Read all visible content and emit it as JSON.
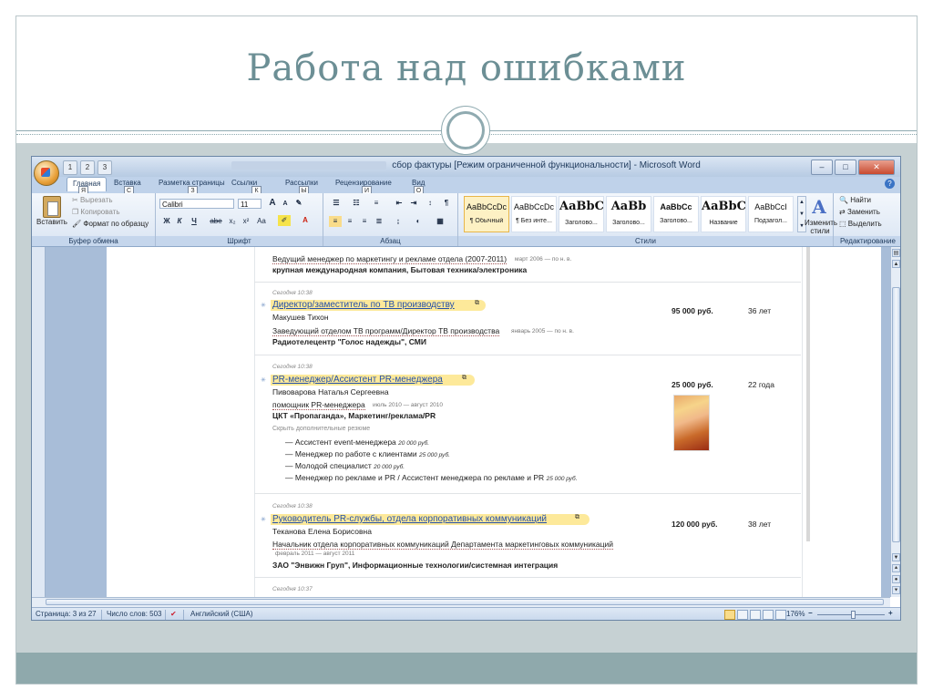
{
  "slide": {
    "title": "Работа над ошибками"
  },
  "window": {
    "title": "сбор фактуры [Режим ограниченной функциональности] - Microsoft Word",
    "controls": {
      "minimize": "–",
      "maximize": "□",
      "close": "✕"
    }
  },
  "qat": {
    "keys": [
      "1",
      "2",
      "3"
    ]
  },
  "ribbon": {
    "tabs": [
      {
        "label": "Главная",
        "key": "Я"
      },
      {
        "label": "Вставка",
        "key": "С"
      },
      {
        "label": "Разметка страницы",
        "key": "З"
      },
      {
        "label": "Ссылки",
        "key": "К"
      },
      {
        "label": "Рассылки",
        "key": "Ы"
      },
      {
        "label": "Рецензирование",
        "key": "И"
      },
      {
        "label": "Вид",
        "key": "О"
      }
    ],
    "help": "?",
    "clipboard": {
      "label": "Буфер обмена",
      "paste": "Вставить",
      "cut": "Вырезать",
      "copy": "Копировать",
      "format_painter": "Формат по образцу"
    },
    "font": {
      "label": "Шрифт",
      "family": "Calibri",
      "size": "11",
      "grow": "A",
      "shrink": "A",
      "bold": "Ж",
      "italic": "К",
      "underline": "Ч",
      "strike": "abe",
      "subscript": "x₂",
      "superscript": "x²",
      "case": "Aa"
    },
    "paragraph": {
      "label": "Абзац"
    },
    "styles": {
      "label": "Стили",
      "items": [
        {
          "sample": "AaBbCcDc",
          "name": "¶ Обычный"
        },
        {
          "sample": "AaBbCcDc",
          "name": "¶ Без инте..."
        },
        {
          "sample": "AaBbC",
          "name": "Заголово..."
        },
        {
          "sample": "AaBb",
          "name": "Заголово..."
        },
        {
          "sample": "AaBbCc",
          "name": "Заголово..."
        },
        {
          "sample": "AaBbC",
          "name": "Название"
        },
        {
          "sample": "AaBbCcI",
          "name": "Подзагол..."
        }
      ],
      "change_styles": "Изменить стили"
    },
    "editing": {
      "label": "Редактирование",
      "find": "Найти",
      "replace": "Заменить",
      "select": "Выделить"
    }
  },
  "document": {
    "top_entry": {
      "position": "Ведущий менеджер по маркетингу и рекламе отдела (2007-2011)",
      "period": "март 2006 — по н. в.",
      "company": "крупная международная компания, Бытовая техника/электроника"
    },
    "entries": [
      {
        "time": "Сегодня 10:38",
        "title": "Директор/заместитель по ТВ производству",
        "name": "Макушев Тихон",
        "salary": "95 000 руб.",
        "age": "36 лет",
        "position": "Заведующий отделом ТВ программ/Директор ТВ производства",
        "period": "январь 2005 — по н. в.",
        "company": "Радиотелецентр \"Голос надежды\", СМИ"
      },
      {
        "time": "Сегодня 10:38",
        "title": "PR-менеджер/Ассистент PR-менеджера",
        "name": "Пивоварова Наталья Сергеевна",
        "salary": "25 000 руб.",
        "age": "22 года",
        "position": "помощник PR-менеджера",
        "period": "июль 2010 — август 2010",
        "company": "ЦКТ «Пропаганда», Маркетинг/реклама/PR",
        "hide_more": "Скрыть дополнительные резюме",
        "more": [
          {
            "title": "Ассистент event-менеджера",
            "salary": "20 000 руб."
          },
          {
            "title": "Менеджер по работе с клиентами",
            "salary": "25 000 руб."
          },
          {
            "title": "Молодой специалист",
            "salary": "20 000 руб."
          },
          {
            "title": "Менеджер по рекламе и PR / Ассистент менеджера по рекламе и PR",
            "salary": "25 000 руб."
          }
        ]
      },
      {
        "time": "Сегодня 10:38",
        "title": "Руководитель PR-службы, отдела корпоративных коммуникаций",
        "name": "Теканова Елена Борисовна",
        "salary": "120 000 руб.",
        "age": "38 лет",
        "position": "Начальник отдела корпоративных коммуникаций Департамента маркетинговых коммуникаций",
        "period": "февраль 2011 — август 2011",
        "company": "ЗАО \"Энвижн Груп\", Информационные технологии/системная интеграция"
      }
    ],
    "last_time": "Сегодня 10:37"
  },
  "statusbar": {
    "page": "Страница: 3 из 27",
    "words": "Число слов: 503",
    "language": "Английский (США)",
    "zoom": "176%",
    "zoom_minus": "−",
    "zoom_plus": "+"
  }
}
